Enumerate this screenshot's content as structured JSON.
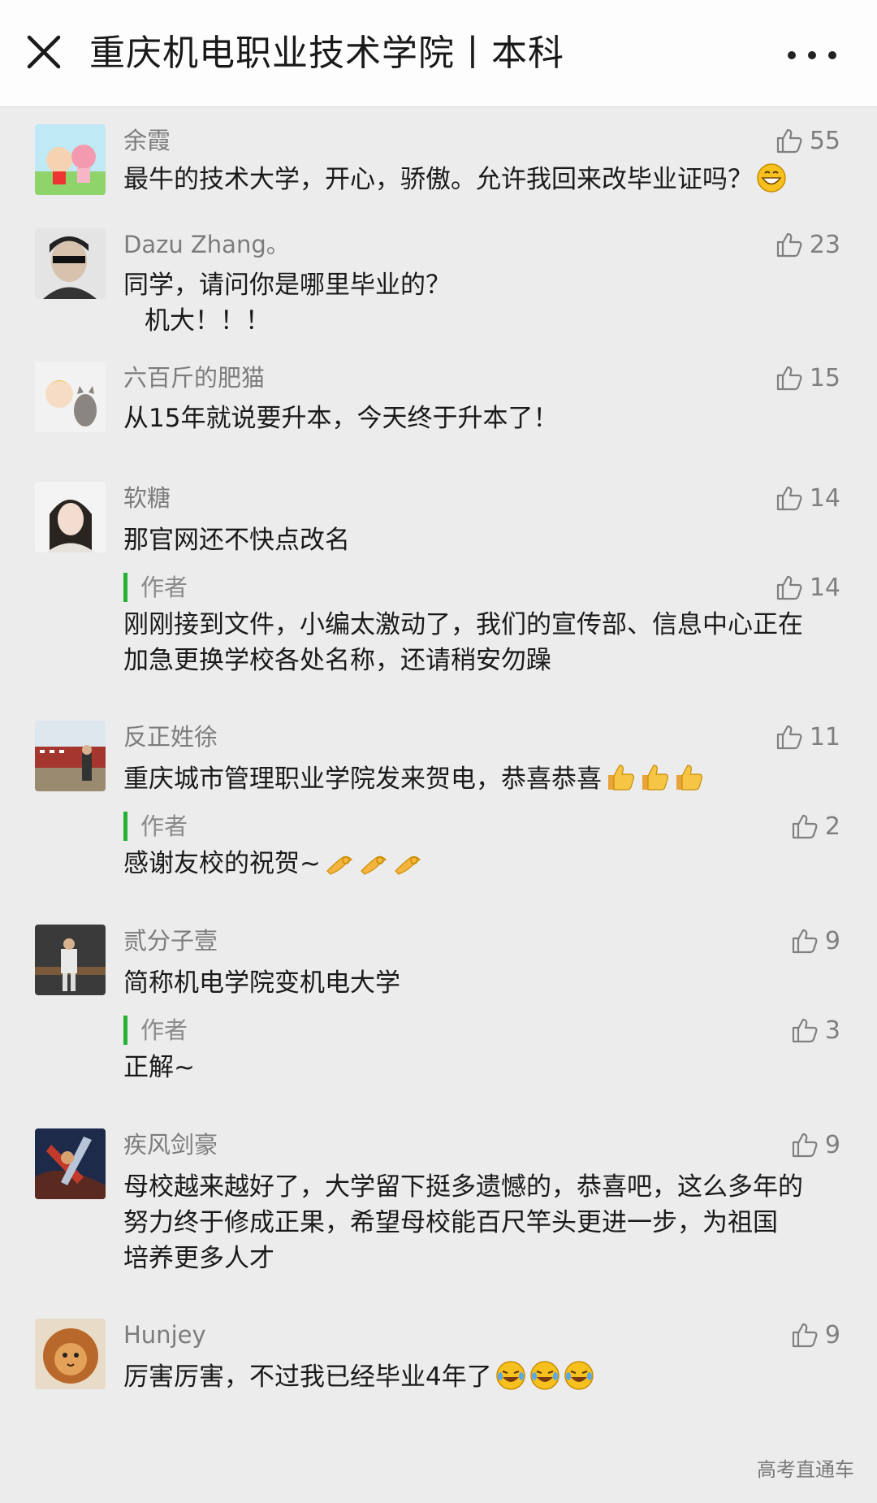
{
  "header": {
    "title": "重庆机电职业技术学院丨本科"
  },
  "comments": [
    {
      "name": "余霞",
      "likes": "55",
      "text": "最牛的技术大学，开心，骄傲。允许我回来改毕业证吗？",
      "emoji": "grinning-face-icon"
    },
    {
      "name": "Dazu Zhang。",
      "likes": "23",
      "text_lines": [
        "同学，请问你是哪里毕业的？",
        "机大！！！"
      ]
    },
    {
      "name": "六百斤的肥猫",
      "likes": "15",
      "text": "从15年就说要升本，今天终于升本了！"
    },
    {
      "name": "软糖",
      "likes": "14",
      "text": "那官网还不快点改名",
      "reply": {
        "author_label": "作者",
        "likes": "14",
        "text_lines": [
          "刚刚接到文件，小编太激动了，我们的宣传部、信息中心正在",
          "加急更换学校各处名称，还请稍安勿躁"
        ]
      }
    },
    {
      "name": "反正姓徐",
      "likes": "11",
      "text": "重庆城市管理职业学院发来贺电，恭喜恭喜",
      "emoji": "thumbs-up-icon",
      "reply": {
        "author_label": "作者",
        "likes": "2",
        "text": "感谢友校的祝贺~",
        "emoji": "ok-hand-icon"
      }
    },
    {
      "name": "贰分子壹",
      "likes": "9",
      "text": "简称机电学院变机电大学",
      "reply": {
        "author_label": "作者",
        "likes": "3",
        "text": "正解~"
      }
    },
    {
      "name": "疾风剑豪",
      "likes": "9",
      "text_lines": [
        "母校越来越好了，大学留下挺多遗憾的，恭喜吧，这么多年的",
        "努力终于修成正果，希望母校能百尺竿头更进一步，为祖国",
        "培养更多人才"
      ]
    },
    {
      "name": "Hunjey",
      "likes": "9",
      "text": "厉害厉害，不过我已经毕业4年了",
      "emoji": "crying-laughing-icon"
    }
  ],
  "watermark": "高考直通车",
  "colors": {
    "author_bar": "#25b135",
    "background": "#ececec",
    "header_bg": "#fdfdfd"
  }
}
